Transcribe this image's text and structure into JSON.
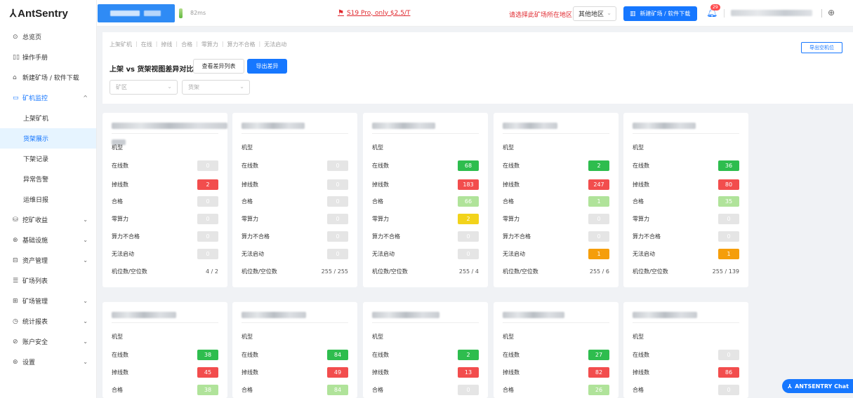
{
  "app": {
    "logo_mark": "⅄",
    "logo_text": "AntSentry"
  },
  "sidebar": {
    "items": [
      {
        "icon": "⊙",
        "label": "总览页",
        "chevron": ""
      },
      {
        "icon": "▯▯",
        "label": "操作手册",
        "chevron": ""
      },
      {
        "icon": "⌂",
        "label": "新建矿场 / 软件下载",
        "chevron": ""
      },
      {
        "icon": "▭",
        "label": "矿机监控",
        "chevron": "^"
      }
    ],
    "sub_items": [
      {
        "label": "上架矿机"
      },
      {
        "label": "货架展示"
      },
      {
        "label": "下架记录"
      },
      {
        "label": "异常告警"
      },
      {
        "label": "运维日报"
      }
    ],
    "items2": [
      {
        "icon": "⛁",
        "label": "挖矿收益",
        "chevron": "⌄"
      },
      {
        "icon": "⊛",
        "label": "基础设施",
        "chevron": "⌄"
      },
      {
        "icon": "⊟",
        "label": "资产管理",
        "chevron": "⌄"
      },
      {
        "icon": "☰",
        "label": "矿场列表",
        "chevron": ""
      },
      {
        "icon": "⊞",
        "label": "矿场管理",
        "chevron": "⌄"
      },
      {
        "icon": "◷",
        "label": "统计报表",
        "chevron": "⌄"
      },
      {
        "icon": "⊘",
        "label": "账户安全",
        "chevron": "⌄"
      },
      {
        "icon": "⊚",
        "label": "设置",
        "chevron": "⌄"
      }
    ]
  },
  "header": {
    "ping": "82ms",
    "promo": "S19 Pro, only $2.5/T",
    "region_label": "请选择此矿场所在地区：",
    "region_value": "其他地区",
    "new_button": "新建矿场 / 软件下载",
    "bell_badge": "29"
  },
  "panel": {
    "breadcrumbs": [
      "上架矿机",
      "在线",
      "掉线",
      "合格",
      "零算力",
      "算力不合格",
      "无法启动"
    ],
    "title": "上架 vs 货架视图差异对比",
    "view_diff_button": "查看差异列表",
    "export_diff_button": "导出差异",
    "farm_placeholder": "矿区",
    "rack_placeholder": "货架",
    "export_empty_button": "导出空机位"
  },
  "labels": {
    "model": "机型",
    "online": "在线数",
    "offline": "掉线数",
    "qualified": "合格",
    "zero_hash": "零算力",
    "hash_unqualified": "算力不合格",
    "cannot_start": "无法启动",
    "slots": "机位数/空位数"
  },
  "cards_row1": [
    {
      "online": "0",
      "offline": "2",
      "qualified": "0",
      "zero": "0",
      "unq": "0",
      "nostart": "0",
      "slots": "4 / 2"
    },
    {
      "online": "0",
      "offline": "0",
      "qualified": "0",
      "zero": "0",
      "unq": "0",
      "nostart": "0",
      "slots": "255 / 255"
    },
    {
      "online": "68",
      "offline": "183",
      "qualified": "66",
      "zero": "2",
      "unq": "0",
      "nostart": "0",
      "slots": "255 / 4"
    },
    {
      "online": "2",
      "offline": "247",
      "qualified": "1",
      "zero": "0",
      "unq": "0",
      "nostart": "1",
      "slots": "255 / 6"
    },
    {
      "online": "36",
      "offline": "80",
      "qualified": "35",
      "zero": "0",
      "unq": "0",
      "nostart": "1",
      "slots": "255 / 139"
    }
  ],
  "cards_row2": [
    {
      "online": "38",
      "offline": "45",
      "qualified": "38"
    },
    {
      "online": "84",
      "offline": "49",
      "qualified": "84"
    },
    {
      "online": "2",
      "offline": "13",
      "qualified": "0"
    },
    {
      "online": "27",
      "offline": "82",
      "qualified": "26"
    },
    {
      "online": "0",
      "offline": "86",
      "qualified": "0"
    }
  ],
  "chat": {
    "label": "ANTSENTRY Chat"
  },
  "colors": {
    "accent": "#1677ff",
    "green": "#2ebd4e",
    "red": "#f24d4d",
    "light_green": "#b0e39a",
    "yellow": "#f2d31b",
    "orange": "#f59e0b",
    "gray": "#e5e5e5"
  }
}
